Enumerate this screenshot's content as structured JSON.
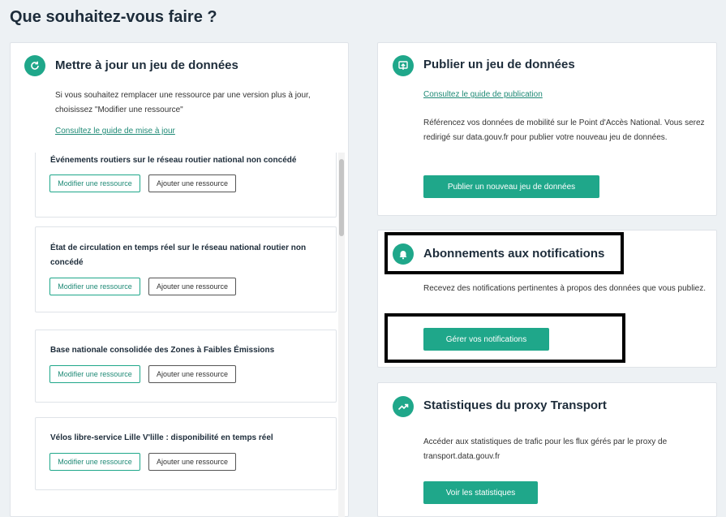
{
  "page": {
    "title": "Que souhaitez-vous faire ?"
  },
  "update_panel": {
    "title": "Mettre à jour un jeu de données",
    "description": "Si vous souhaitez remplacer une ressource par une version plus à jour, choisissez \"Modifier une ressource\"",
    "guide_link": "Consultez le guide de mise à jour",
    "datasets": [
      {
        "title": "Événements routiers sur le réseau routier national non concédé",
        "modify_label": "Modifier une ressource",
        "add_label": "Ajouter une ressource"
      },
      {
        "title": "État de circulation en temps réel sur le réseau national routier non concédé",
        "modify_label": "Modifier une ressource",
        "add_label": "Ajouter une ressource"
      },
      {
        "title": "Base nationale consolidée des Zones à Faibles Émissions",
        "modify_label": "Modifier une ressource",
        "add_label": "Ajouter une ressource"
      },
      {
        "title": "Vélos libre-service Lille V'lille : disponibilité en temps réel",
        "modify_label": "Modifier une ressource",
        "add_label": "Ajouter une ressource"
      }
    ]
  },
  "publish_panel": {
    "title": "Publier un jeu de données",
    "guide_link": "Consultez le guide de publication",
    "description": "Référencez vos données de mobilité sur le Point d'Accès National. Vous serez redirigé sur data.gouv.fr pour publier votre nouveau jeu de données.",
    "button_label": "Publier un nouveau jeu de données"
  },
  "notifications_panel": {
    "title": "Abonnements aux notifications",
    "description": "Recevez des notifications pertinentes à propos des données que vous publiez.",
    "button_label": "Gérer vos notifications"
  },
  "stats_panel": {
    "title": "Statistiques du proxy Transport",
    "description": "Accéder aux statistiques de trafic pour les flux gérés par le proxy de transport.data.gouv.fr",
    "button_label": "Voir les statistiques"
  },
  "icons": {
    "update": "refresh-icon",
    "publish": "upload-icon",
    "notifications": "bell-icon",
    "stats": "trending-up-icon"
  },
  "colors": {
    "accent": "#1fa78a",
    "background": "#edf1f4",
    "highlight": "#000000"
  }
}
